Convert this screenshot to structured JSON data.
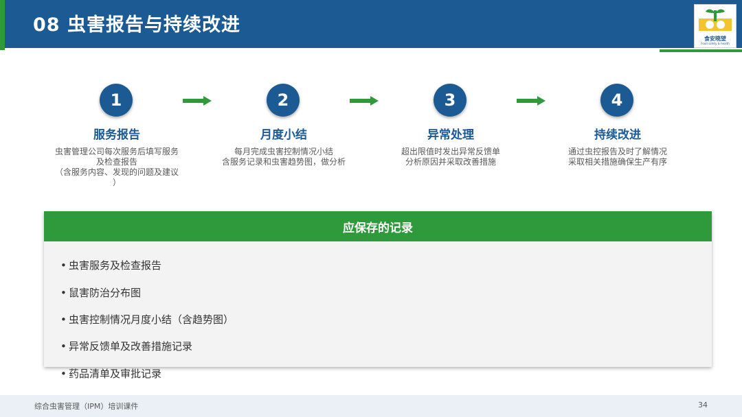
{
  "header": {
    "title": "08  虫害报告与持续改进",
    "logo_text": "食安晓望",
    "logo_subtext": "Food safety & health"
  },
  "colors": {
    "primary_blue": "#1c5a94",
    "accent_green": "#2e9a3c"
  },
  "steps": [
    {
      "number": "1",
      "title": "服务报告",
      "desc_lines": [
        "虫害管理公司每次服务后填写服务",
        "及检查报告",
        "（含服务内容、发现的问题及建议",
        "）"
      ]
    },
    {
      "number": "2",
      "title": "月度小结",
      "desc_lines": [
        "每月完成虫害控制情况小结",
        "含服务记录和虫害趋势图，做分析"
      ]
    },
    {
      "number": "3",
      "title": "异常处理",
      "desc_lines": [
        "超出限值时发出异常反馈单",
        "分析原因并采取改善措施"
      ]
    },
    {
      "number": "4",
      "title": "持续改进",
      "desc_lines": [
        "通过虫控报告及时了解情况",
        "采取相关措施确保生产有序"
      ]
    }
  ],
  "records": {
    "heading": "应保存的记录",
    "bullet": "•",
    "items": [
      "虫害服务及检查报告",
      "鼠害防治分布图",
      "虫害控制情况月度小结（含趋势图）",
      "异常反馈单及改善措施记录",
      "药品清单及审批记录"
    ]
  },
  "footer": {
    "text": "综合虫害管理（IPM）培训课件",
    "page": "34"
  }
}
